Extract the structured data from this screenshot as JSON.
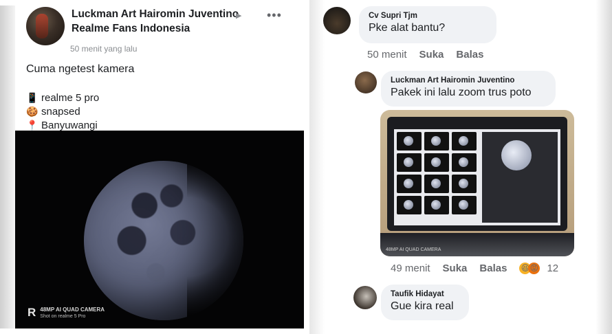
{
  "post": {
    "author": "Luckman Art Hairomin Juventino",
    "arrow": "▶",
    "group": "Realme Fans Indonesia",
    "more": "•••",
    "time": "50 menit yang lalu",
    "text": "Cuma ngetest kamera",
    "lines": [
      {
        "icon": "📱",
        "text": "realme 5 pro"
      },
      {
        "icon": "🍪",
        "text": "snapsed"
      },
      {
        "icon": "📍",
        "text": "Banyuwangi"
      }
    ],
    "watermark": {
      "logo": "R",
      "line1": "48MP AI QUAD CAMERA",
      "line2": "Shot on realme 5 Pro"
    }
  },
  "comments": [
    {
      "name": "Cv Supri Tjm",
      "text": "Pke alat bantu?",
      "time": "50 menit",
      "like": "Suka",
      "reply": "Balas"
    },
    {
      "name": "Luckman Art Hairomin Juventino",
      "text": "Pakek ini lalu zoom trus poto",
      "time": "49 menit",
      "like": "Suka",
      "reply": "Balas",
      "reaction_count": "12",
      "reactions": [
        "😆",
        "😡"
      ],
      "photo_watermark": "48MP AI QUAD CAMERA"
    },
    {
      "name": "Taufik Hidayat",
      "text": "Gue kira real"
    }
  ]
}
